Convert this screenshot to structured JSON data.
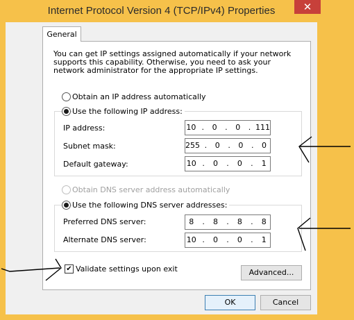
{
  "window": {
    "title": "Internet Protocol Version 4 (TCP/IPv4) Properties",
    "close_glyph": "✕",
    "accent_color": "#f6c14a"
  },
  "tabs": [
    {
      "label": "General"
    }
  ],
  "info_text": "You can get IP settings assigned automatically if your network supports this capability. Otherwise, you need to ask your network administrator for the appropriate IP settings.",
  "ip": {
    "auto_label": "Obtain an IP address automatically",
    "manual_label": "Use the following IP address:",
    "selected": "manual",
    "fields": [
      {
        "label": "IP address:",
        "octets": [
          "10",
          "0",
          "0",
          "111"
        ]
      },
      {
        "label": "Subnet mask:",
        "octets": [
          "255",
          "0",
          "0",
          "0"
        ]
      },
      {
        "label": "Default gateway:",
        "octets": [
          "10",
          "0",
          "0",
          "1"
        ]
      }
    ]
  },
  "dns": {
    "auto_label": "Obtain DNS server address automatically",
    "manual_label": "Use the following DNS server addresses:",
    "selected": "manual",
    "fields": [
      {
        "label": "Preferred DNS server:",
        "octets": [
          "8",
          "8",
          "8",
          "8"
        ]
      },
      {
        "label": "Alternate DNS server:",
        "octets": [
          "10",
          "0",
          "0",
          "1"
        ]
      }
    ]
  },
  "validate": {
    "label": "Validate settings upon exit",
    "checked": true,
    "check_glyph": "✔"
  },
  "buttons": {
    "advanced": "Advanced...",
    "ok": "OK",
    "cancel": "Cancel"
  }
}
